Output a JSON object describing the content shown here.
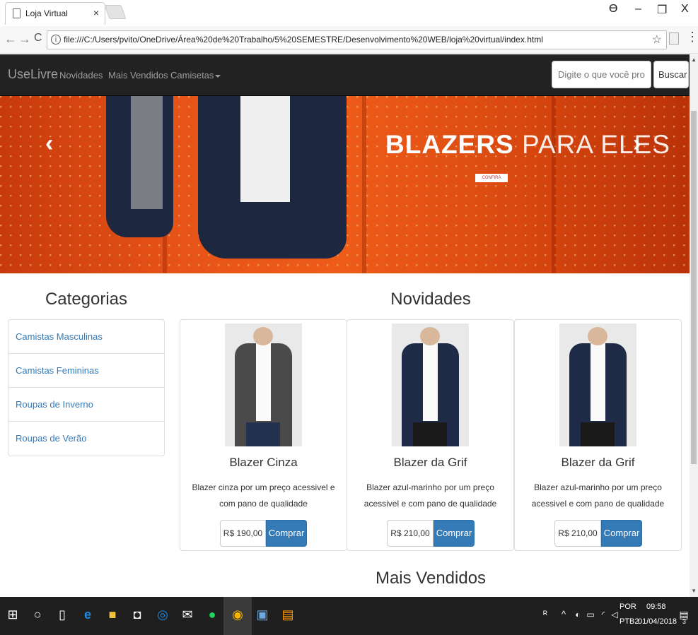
{
  "browser": {
    "tab_title": "Loja Virtual",
    "tab_close": "×",
    "url": "file:///C:/Users/pvito/OneDrive/Área%20de%20Trabalho/5%20SEMESTRE/Desenvolvimento%20WEB/loja%20virtual/index.html",
    "star": "☆",
    "menu": "⋮",
    "back": "←",
    "forward": "→",
    "reload": "C",
    "info": "i",
    "profile": "Ɵ",
    "minimize": "–",
    "maximize": "❐",
    "close": "X"
  },
  "navbar": {
    "brand": "UseLivre",
    "links": [
      "Novidades",
      "Mais Vendidos",
      "Camisetas"
    ],
    "search_placeholder": "Digite o que você procura",
    "search_button": "Buscar"
  },
  "carousel": {
    "headline_bold": "BLAZERS",
    "headline_light": "PARA ELES",
    "tag": "CONFIRA",
    "prev": "‹",
    "next": "›"
  },
  "sidebar": {
    "title": "Categorias",
    "items": [
      "Camistas Masculinas",
      "Camistas Femininas",
      "Roupas de Inverno",
      "Roupas de Verão"
    ]
  },
  "novidades": {
    "title": "Novidades",
    "products": [
      {
        "name": "Blazer Cinza",
        "desc": "Blazer cinza por um preço acessivel e com pano de qualidade",
        "price": "R$ 190,00",
        "buy": "Comprar",
        "jacket_color": "#4a4a4a"
      },
      {
        "name": "Blazer da Grif",
        "desc": "Blazer azul-marinho por um preço acessivel e com pano de qualidade",
        "price": "R$ 210,00",
        "buy": "Comprar",
        "jacket_color": "#1f2a47"
      },
      {
        "name": "Blazer da Grif",
        "desc": "Blazer azul-marinho por um preço acessivel e com pano de qualidade",
        "price": "R$ 210,00",
        "buy": "Comprar",
        "jacket_color": "#1f2a47"
      }
    ]
  },
  "mais_vendidos": {
    "title": "Mais Vendidos"
  },
  "taskbar": {
    "lang_top": "POR",
    "lang_bottom": "PTB2",
    "time": "09:58",
    "date": "01/04/2018",
    "notifications": "3"
  }
}
